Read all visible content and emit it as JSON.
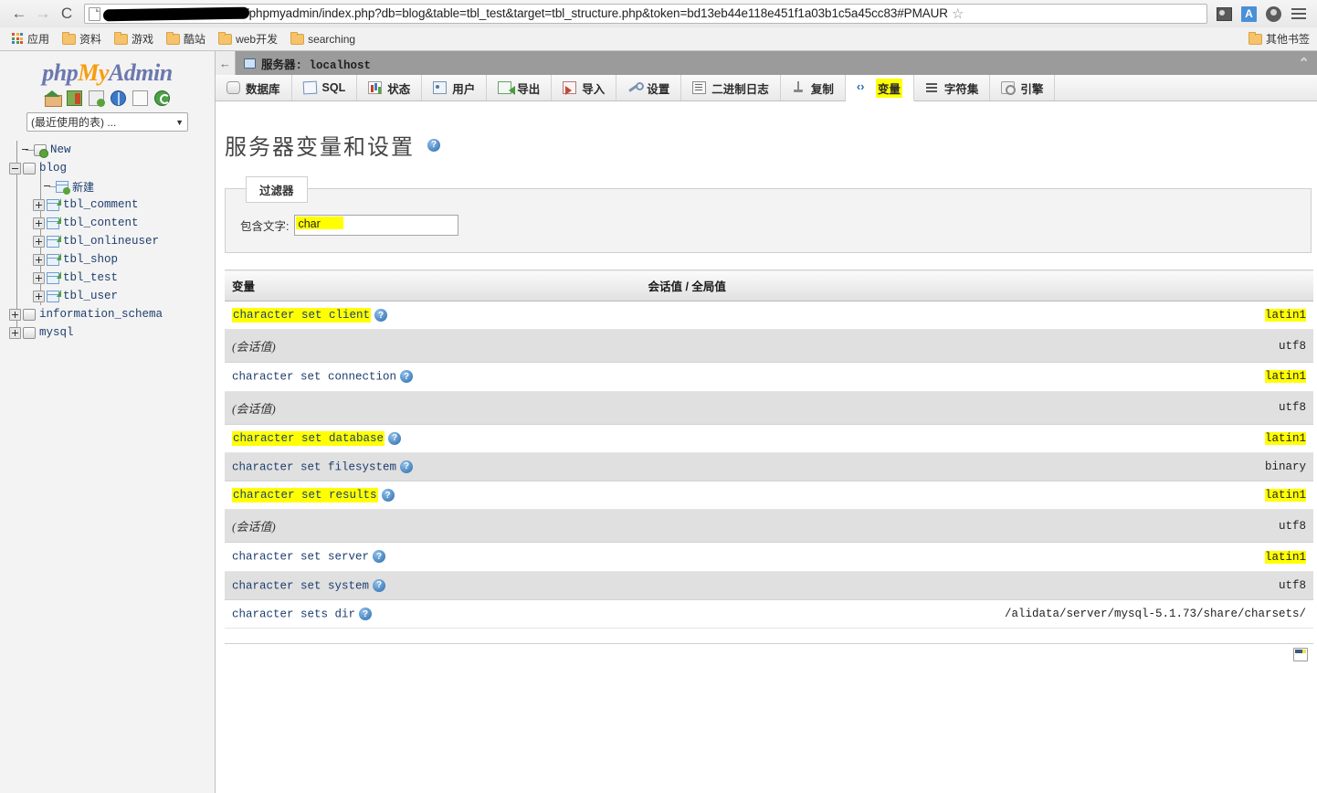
{
  "browser": {
    "back_icon": "←",
    "forward_icon": "→",
    "reload_icon": "C",
    "url_text": "/phpmyadmin/index.php?db=blog&table=tbl_test&target=tbl_structure.php&token=bd13eb44e118e451f1a03b1c5a45cc83#PMAUR",
    "star_icon": "☆",
    "translate_letter": "A",
    "bookmarks": [
      {
        "label": "应用",
        "icon": "apps-grid-icon"
      },
      {
        "label": "资料",
        "icon": "folder-icon"
      },
      {
        "label": "游戏",
        "icon": "folder-icon"
      },
      {
        "label": "酷站",
        "icon": "folder-icon"
      },
      {
        "label": "web开发",
        "icon": "folder-icon"
      },
      {
        "label": "searching",
        "icon": "folder-icon"
      }
    ],
    "other_bookmarks": "其他书签"
  },
  "sidebar": {
    "logo": {
      "php": "php",
      "my": "My",
      "admin": "Admin"
    },
    "icons": [
      "home-icon",
      "logout-icon",
      "docs-icon",
      "globe-icon",
      "page-icon",
      "reload-icon"
    ],
    "recent_select": {
      "value": "(最近使用的表) ...",
      "caret": "▼"
    },
    "tree": [
      {
        "label": "New",
        "type": "new-db",
        "depth": 1,
        "expander": "none"
      },
      {
        "label": "blog",
        "type": "db",
        "depth": 1,
        "expander": "minus"
      },
      {
        "label": "新建",
        "type": "new-table",
        "depth": 2,
        "expander": "none",
        "cn": true
      },
      {
        "label": "tbl_comment",
        "type": "table",
        "depth": 2,
        "expander": "plus"
      },
      {
        "label": "tbl_content",
        "type": "table",
        "depth": 2,
        "expander": "plus"
      },
      {
        "label": "tbl_onlineuser",
        "type": "table",
        "depth": 2,
        "expander": "plus"
      },
      {
        "label": "tbl_shop",
        "type": "table",
        "depth": 2,
        "expander": "plus"
      },
      {
        "label": "tbl_test",
        "type": "table",
        "depth": 2,
        "expander": "plus"
      },
      {
        "label": "tbl_user",
        "type": "table",
        "depth": 2,
        "expander": "plus"
      },
      {
        "label": "information_schema",
        "type": "db",
        "depth": 1,
        "expander": "plus"
      },
      {
        "label": "mysql",
        "type": "db",
        "depth": 1,
        "expander": "plus"
      }
    ]
  },
  "server_bar": {
    "back_icon": "←",
    "label": "服务器: localhost",
    "collapse_icon": "⌃"
  },
  "tabs": [
    {
      "label": "数据库",
      "icon": "database-icon",
      "active": false
    },
    {
      "label": "SQL",
      "icon": "sql-icon",
      "active": false
    },
    {
      "label": "状态",
      "icon": "status-icon",
      "active": false
    },
    {
      "label": "用户",
      "icon": "users-icon",
      "active": false
    },
    {
      "label": "导出",
      "icon": "export-icon",
      "active": false
    },
    {
      "label": "导入",
      "icon": "import-icon",
      "active": false
    },
    {
      "label": "设置",
      "icon": "settings-wrench-icon",
      "active": false
    },
    {
      "label": "二进制日志",
      "icon": "binlog-icon",
      "active": false
    },
    {
      "label": "复制",
      "icon": "replication-icon",
      "active": false
    },
    {
      "label": "变量",
      "icon": "variables-icon",
      "active": true,
      "highlighted": true
    },
    {
      "label": "字符集",
      "icon": "charset-icon",
      "active": false
    },
    {
      "label": "引擎",
      "icon": "engines-icon",
      "active": false
    }
  ],
  "main": {
    "page_title": "服务器变量和设置",
    "title_help_icon": "?",
    "filter": {
      "legend": "过滤器",
      "label": "包含文字:",
      "value": "char",
      "placeholder": ""
    },
    "table": {
      "headers": [
        "变量",
        "会话值 / 全局值"
      ],
      "rows": [
        {
          "name": "character set client",
          "name_highlighted": true,
          "help": true,
          "value": "latin1",
          "value_highlighted": true,
          "session": false
        },
        {
          "name": "(会话值)",
          "name_highlighted": false,
          "help": false,
          "value": "utf8",
          "value_highlighted": false,
          "session": true
        },
        {
          "name": "character set connection",
          "name_highlighted": false,
          "help": true,
          "value": "latin1",
          "value_highlighted": true,
          "session": false
        },
        {
          "name": "(会话值)",
          "name_highlighted": false,
          "help": false,
          "value": "utf8",
          "value_highlighted": false,
          "session": true
        },
        {
          "name": "character set database",
          "name_highlighted": true,
          "help": true,
          "value": "latin1",
          "value_highlighted": true,
          "session": false
        },
        {
          "name": "character set filesystem",
          "name_highlighted": false,
          "help": true,
          "value": "binary",
          "value_highlighted": false,
          "session": false
        },
        {
          "name": "character set results",
          "name_highlighted": true,
          "help": true,
          "value": "latin1",
          "value_highlighted": true,
          "session": false
        },
        {
          "name": "(会话值)",
          "name_highlighted": false,
          "help": false,
          "value": "utf8",
          "value_highlighted": false,
          "session": true
        },
        {
          "name": "character set server",
          "name_highlighted": false,
          "help": true,
          "value": "latin1",
          "value_highlighted": true,
          "session": false
        },
        {
          "name": "character set system",
          "name_highlighted": false,
          "help": true,
          "value": "utf8",
          "value_highlighted": false,
          "session": false
        },
        {
          "name": "character sets dir",
          "name_highlighted": false,
          "help": true,
          "value": "/alidata/server/mysql-5.1.73/share/charsets/",
          "value_highlighted": false,
          "session": false
        }
      ]
    }
  },
  "colors": {
    "highlight": "#ffff00",
    "link": "#1d3e6e",
    "row_even": "#e0e0e0",
    "server_bar": "#9b9b9b"
  }
}
